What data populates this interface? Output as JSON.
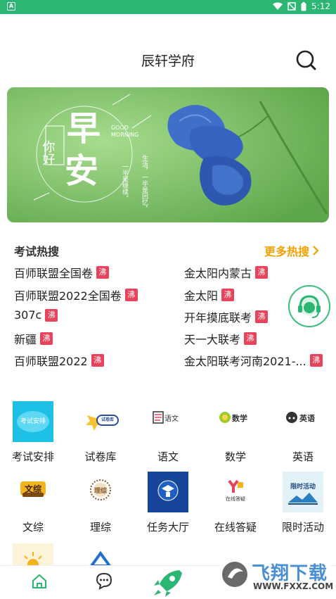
{
  "status_bar": {
    "time": "5:12",
    "app_badge": "A"
  },
  "header": {
    "title": "辰轩学府"
  },
  "banner": {
    "greeting_small": "你好",
    "greeting_big_1": "早",
    "greeting_big_2": "安",
    "good_morning_1": "GOOD",
    "good_morning_2": "MORNING",
    "poem_right": "生活，一半是回忆，",
    "poem_left": "一半是继续。"
  },
  "hot_search": {
    "title": "考试热搜",
    "more_label": "更多热搜",
    "badge": "沸",
    "left": [
      "百师联盟全国卷",
      "百师联盟2022全国卷",
      "307c",
      "新疆",
      "百师联盟2022"
    ],
    "right": [
      "金太阳内蒙古",
      "金太阳",
      "开年摸底联考",
      "天一大联考",
      "金太阳联考河南2021-..."
    ]
  },
  "grid": {
    "row1": [
      {
        "label": "考试安排",
        "icon": "exam-schedule-icon",
        "icon_text": "考试安排"
      },
      {
        "label": "试卷库",
        "icon": "paper-library-icon",
        "icon_text": "试卷库"
      },
      {
        "label": "语文",
        "icon": "chinese-icon",
        "icon_text": "语文"
      },
      {
        "label": "数学",
        "icon": "math-icon",
        "icon_text": "数学"
      },
      {
        "label": "英语",
        "icon": "english-icon",
        "icon_text": "英语"
      }
    ],
    "row2": [
      {
        "label": "文综",
        "icon": "liberal-arts-icon",
        "icon_text": "文综"
      },
      {
        "label": "理综",
        "icon": "science-icon",
        "icon_text": "理综"
      },
      {
        "label": "任务大厅",
        "icon": "task-hall-icon",
        "icon_text": ""
      },
      {
        "label": "在线答疑",
        "icon": "online-qa-icon",
        "icon_text": "在线答疑"
      },
      {
        "label": "限时活动",
        "icon": "limited-activity-icon",
        "icon_text": "限时活动"
      }
    ]
  },
  "watermark": {
    "brand": "飞翔下载",
    "url": "WWW.FXXZ.COM"
  },
  "colors": {
    "accent_green": "#2bb673",
    "more_orange": "#f5a000",
    "hot_badge_red": "#e8435a"
  }
}
